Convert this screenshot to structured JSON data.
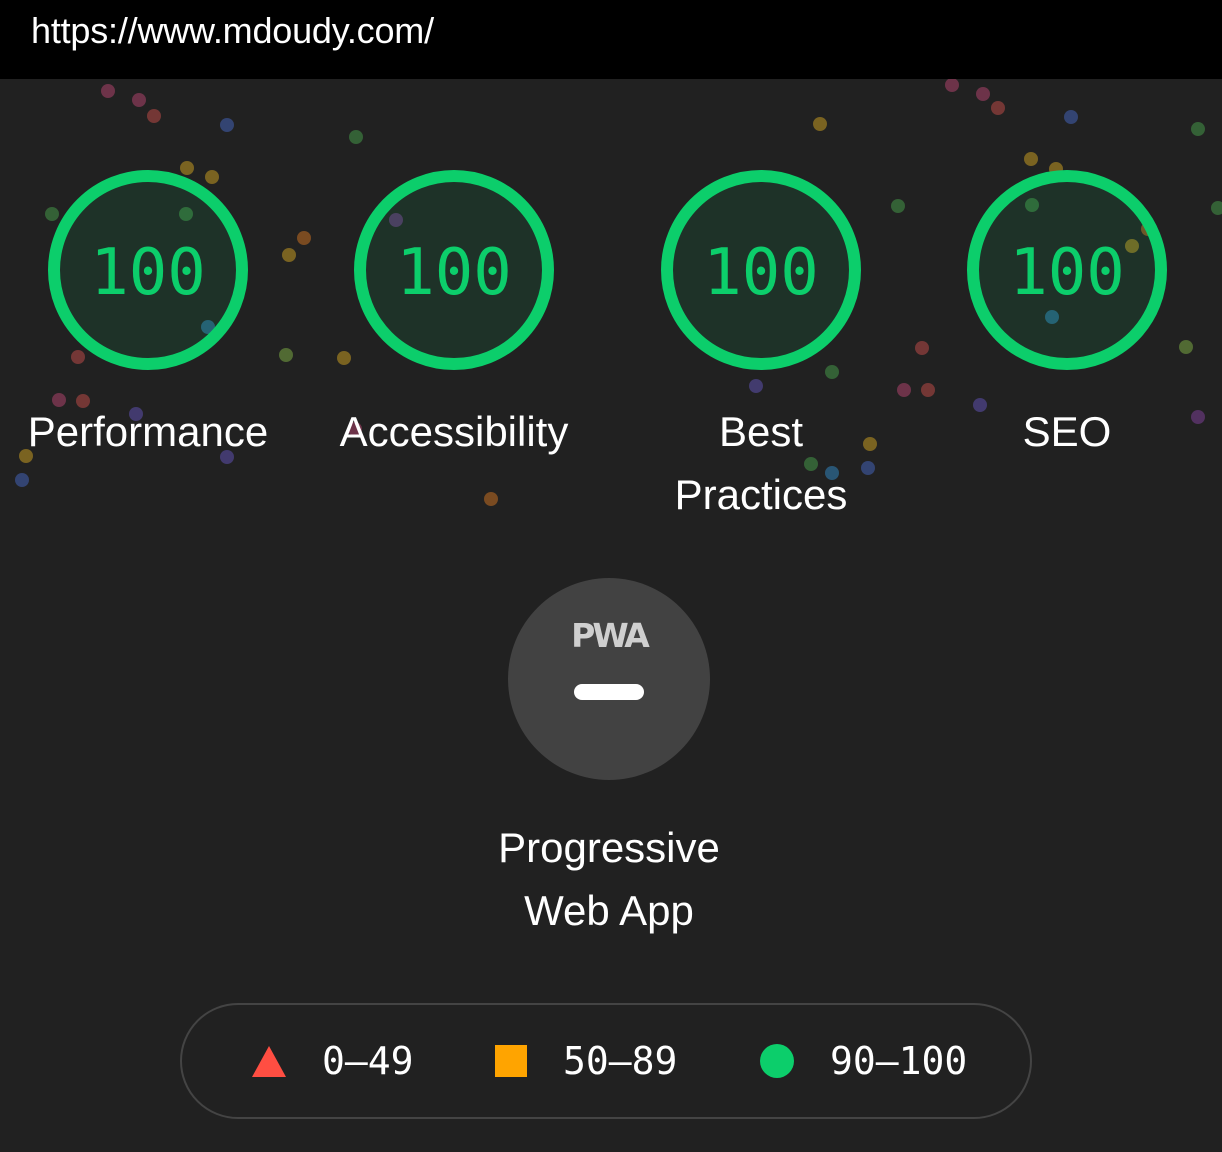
{
  "url_bar": {
    "url": "https://www.mdoudy.com/"
  },
  "colors": {
    "pass": "#0cce6b",
    "average": "#ffa400",
    "fail": "#ff4e42",
    "background": "#212121"
  },
  "gauges": [
    {
      "score": "100",
      "label": "Performance",
      "status": "pass"
    },
    {
      "score": "100",
      "label": "Accessibility",
      "status": "pass"
    },
    {
      "score": "100",
      "label_line1": "Best",
      "label_line2": "Practices",
      "status": "pass"
    },
    {
      "score": "100",
      "label": "SEO",
      "status": "pass"
    }
  ],
  "pwa": {
    "badge_text": "PWA",
    "label_line1": "Progressive",
    "label_line2": "Web App"
  },
  "legend": [
    {
      "range": "0–49",
      "icon": "triangle-icon"
    },
    {
      "range": "50–89",
      "icon": "square-icon"
    },
    {
      "range": "90–100",
      "icon": "circle-icon"
    }
  ]
}
